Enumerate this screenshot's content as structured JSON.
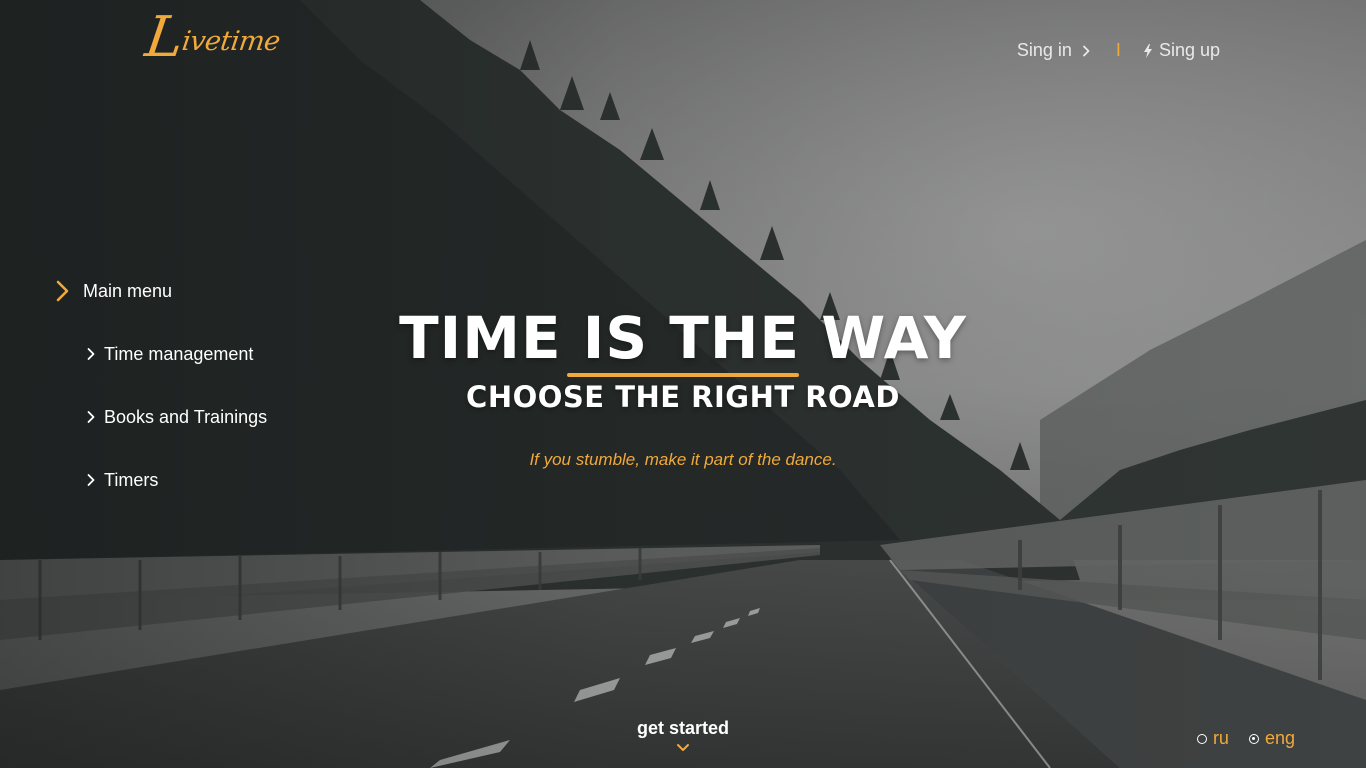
{
  "logo": {
    "initial": "L",
    "rest": "ivetime"
  },
  "auth": {
    "sign_in": "Sing in",
    "separator": "I",
    "sign_up": "Sing up"
  },
  "menu": {
    "main": "Main menu",
    "items": [
      {
        "label": "Time management"
      },
      {
        "label": "Books and Trainings"
      },
      {
        "label": "Timers"
      }
    ]
  },
  "hero": {
    "title": "TIME IS THE WAY",
    "subtitle": "CHOOSE THE RIGHT ROAD",
    "tagline": "If you stumble, make it part of the dance."
  },
  "cta": {
    "label": "get started"
  },
  "language": {
    "options": [
      {
        "label": "ru",
        "selected": false
      },
      {
        "label": "eng",
        "selected": true
      }
    ]
  },
  "colors": {
    "accent": "#f0a93a",
    "text": "#ffffff"
  },
  "icons": {
    "sign_in": "chevron-right-icon",
    "sign_up": "lightning-bolt-icon",
    "menu_main": "chevron-right-icon",
    "menu_item": "chevron-right-icon",
    "cta": "chevron-down-icon",
    "language": "radio-icon"
  }
}
